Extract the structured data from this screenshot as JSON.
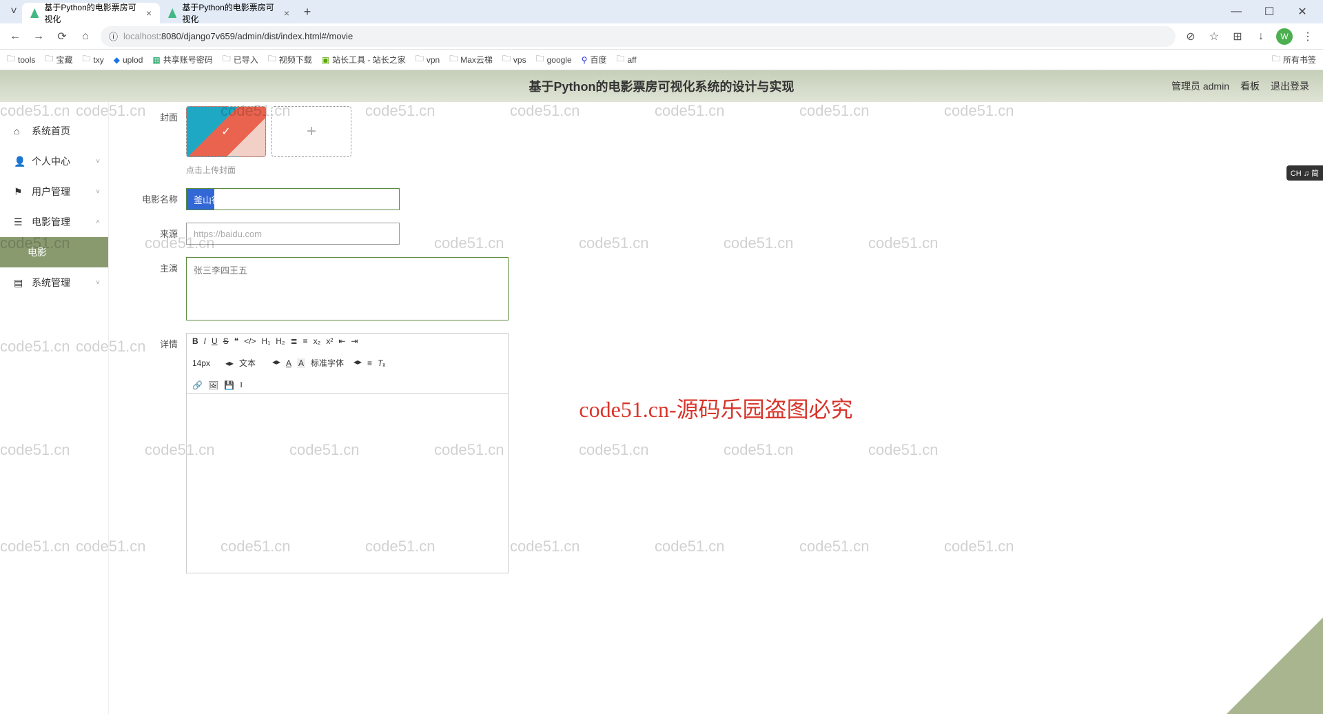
{
  "browser": {
    "tabs": [
      {
        "title": "基于Python的电影票房可视化",
        "active": true
      },
      {
        "title": "基于Python的电影票房可视化",
        "active": false
      }
    ],
    "url_host": "localhost",
    "url_path": ":8080/django7v659/admin/dist/index.html#/movie",
    "profile_letter": "W"
  },
  "bookmarks": {
    "items": [
      "tools",
      "宝藏",
      "txy",
      "uplod",
      "共享账号密码",
      "已导入",
      "视频下载",
      "站长工具 - 站长之家",
      "vpn",
      "Max云梯",
      "vps",
      "google",
      "百度",
      "aff"
    ],
    "all": "所有书签"
  },
  "app": {
    "title": "基于Python的电影票房可视化系统的设计与实现",
    "header_links": {
      "admin": "管理员 admin",
      "board": "看板",
      "logout": "退出登录"
    }
  },
  "sidebar": {
    "items": [
      {
        "label": "系统首页",
        "icon": "home"
      },
      {
        "label": "个人中心",
        "icon": "person",
        "expandable": true
      },
      {
        "label": "用户管理",
        "icon": "flag",
        "expandable": true
      },
      {
        "label": "电影管理",
        "icon": "stack",
        "expandable": true,
        "expanded": true
      },
      {
        "label": "电影",
        "sub": true,
        "active": true
      },
      {
        "label": "系统管理",
        "icon": "list",
        "expandable": true
      }
    ]
  },
  "form": {
    "cover_label": "封面",
    "cover_hint": "点击上传封面",
    "name_label": "电影名称",
    "name_value": "釜山行",
    "source_label": "来源",
    "source_value": "https://baidu.com",
    "actors_label": "主演",
    "actors_value": "张三李四王五",
    "detail_label": "详情"
  },
  "editor": {
    "font_size": "14px",
    "text_type": "文本",
    "font_family": "标准字体"
  },
  "watermark": {
    "small": "code51.cn",
    "big": "code51.cn-源码乐园盗图必究"
  },
  "ime": "CH ♫ 简"
}
